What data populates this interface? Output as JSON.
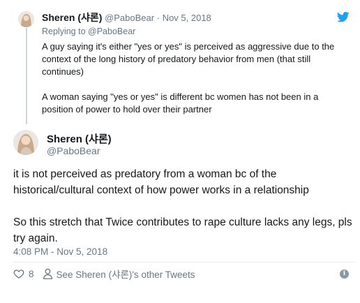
{
  "quoted_tweet": {
    "name": "Sheren (샤론)",
    "handle": "@PaboBear",
    "separator": "·",
    "date": "Nov 5, 2018",
    "replying_prefix": "Replying to",
    "replying_to": "@PaboBear",
    "paragraphs": [
      "A guy saying it's either \"yes or yes\" is perceived as aggressive due to the context of the long history of predatory behavior from men (that still continues)",
      "A woman saying \"yes or yes\" is different bc women has not been in a position of power to hold over their partner"
    ]
  },
  "main_tweet": {
    "name": "Sheren (샤론)",
    "handle": "@PaboBear",
    "paragraphs": [
      "it is not perceived as predatory from a woman bc of the historical/cultural context of how power works in a relationship",
      "So this stretch that Twice contributes to rape culture lacks any legs, pls try again."
    ],
    "timestamp": "4:08 PM - Nov 5, 2018",
    "like_count": "8",
    "other_tweets_label": "See Sheren (샤론)'s other Tweets",
    "info_glyph": "i"
  },
  "colors": {
    "twitter_blue": "#1da1f2",
    "muted": "#657786",
    "text": "#14171a"
  }
}
